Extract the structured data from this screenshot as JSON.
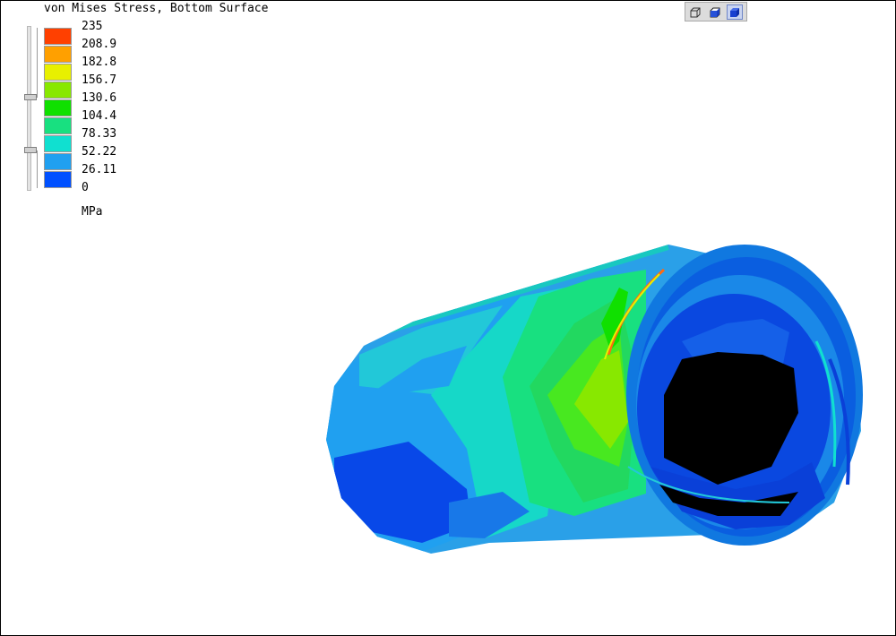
{
  "plot": {
    "title": "von Mises Stress, Bottom Surface",
    "unit": "MPa"
  },
  "legend": {
    "labels": [
      "235",
      "208.9",
      "182.8",
      "156.7",
      "130.6",
      "104.4",
      "78.33",
      "52.22",
      "26.11",
      "0"
    ],
    "colors": [
      "#ff4000",
      "#ffa000",
      "#e8f000",
      "#88e800",
      "#10e000",
      "#18e080",
      "#10e0d0",
      "#20a0f0",
      "#0050ff"
    ]
  },
  "toolbar": {
    "buttons": [
      "wireframe-view-icon",
      "shaded-view-icon",
      "solid-view-icon"
    ],
    "active_index": 2
  }
}
